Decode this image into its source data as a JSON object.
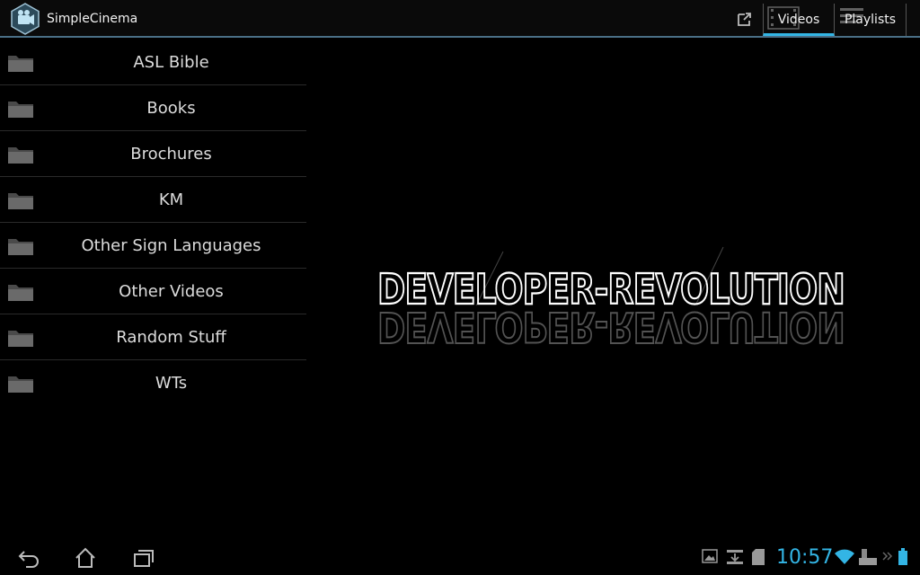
{
  "app": {
    "title": "SimpleCinema"
  },
  "tabs": [
    {
      "label": "Videos",
      "icon": "film-strip-icon",
      "selected": true
    },
    {
      "label": "Playlists",
      "icon": "playlist-icon",
      "selected": false
    }
  ],
  "folders": [
    {
      "label": "ASL Bible"
    },
    {
      "label": "Books"
    },
    {
      "label": "Brochures"
    },
    {
      "label": "KM"
    },
    {
      "label": "Other Sign Languages"
    },
    {
      "label": "Other Videos"
    },
    {
      "label": "Random Stuff"
    },
    {
      "label": "WTs"
    }
  ],
  "logo": {
    "text": "DEVELOPER-REVOLUTION"
  },
  "status": {
    "time": "10:57"
  },
  "colors": {
    "accent": "#33b5e5",
    "background": "#000000",
    "divider": "#4a6f86"
  }
}
